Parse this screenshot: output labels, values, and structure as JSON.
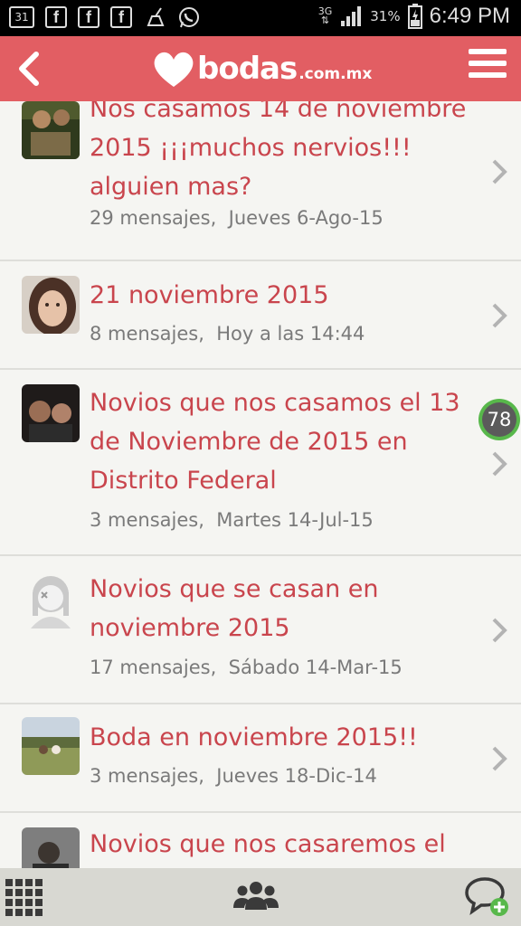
{
  "status_bar": {
    "calendar_day": "31",
    "network": "3G",
    "battery_percent": "31%",
    "time": "6:49 PM",
    "icons": [
      "calendar-icon",
      "facebook-icon",
      "facebook-icon",
      "facebook-icon",
      "cleaner-icon",
      "whatsapp-icon",
      "signal-icon",
      "battery-icon"
    ]
  },
  "header": {
    "logo_text": "bodas",
    "logo_domain": ".com.mx",
    "back_icon": "chevron-left-icon",
    "menu_icon": "hamburger-icon",
    "brand_color": "#e25e63"
  },
  "threads": [
    {
      "title": "Nos casamos 14 de noviembre 2015 ¡¡¡muchos nervios!!! alguien mas?",
      "messages": "29 mensajes,",
      "date": "Jueves 6-Ago-15",
      "avatar": "photo"
    },
    {
      "title": "21 noviembre 2015",
      "messages": "8 mensajes,",
      "date": "Hoy a las 14:44",
      "avatar": "photo"
    },
    {
      "title": "Novios que nos casamos el 13 de Noviembre de 2015 en Distrito Federal",
      "messages": "3 mensajes,",
      "date": "Martes 14-Jul-15",
      "avatar": "photo"
    },
    {
      "title": "Novios que se casan en noviembre 2015",
      "messages": "17 mensajes,",
      "date": "Sábado 14-Mar-15",
      "avatar": "default-user-icon"
    },
    {
      "title": "Boda en noviembre 2015!!",
      "messages": "3 mensajes,",
      "date": "Jueves 18-Dic-14",
      "avatar": "photo"
    },
    {
      "title": "Novios que nos casaremos el",
      "messages": "",
      "date": "",
      "avatar": "photo"
    }
  ],
  "floating_badge": "78",
  "bottom_bar": {
    "icons": [
      "grid-menu-icon",
      "community-icon",
      "new-chat-icon"
    ]
  }
}
